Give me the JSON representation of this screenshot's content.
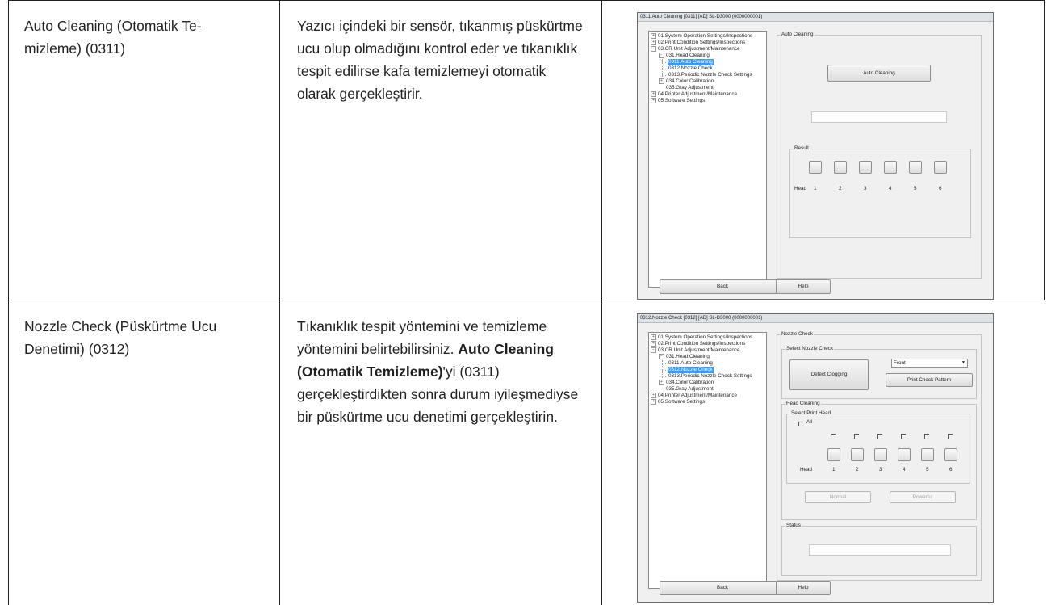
{
  "rows": [
    {
      "name": "Auto Cleaning (Otomatik Te-\nmizleme) (0311)",
      "desc": "Yazıcı içindeki bir sensör, tıkanmış püskürtme ucu olup olmadığını kontrol eder ve tıkanıklık tespit edilirse kafa temizlemeyi otomatik olarak gerçekleştirir."
    },
    {
      "name": "Nozzle Check (Püskürtme Ucu Denetimi) (0312)",
      "desc_part1": "Tıkanıklık tespit yöntemini ve temizleme yöntemini belirtebilirsiniz. ",
      "desc_bold": "Auto Cleaning (Otomatik Temizleme)",
      "desc_part2": "'yi (0311) gerçekleştirdikten sonra durum iyileşmediyse bir püskürtme ucu denetimi gerçekleştirin."
    }
  ],
  "win1": {
    "title": "0311.Auto Cleaning  [0311]  [AD]  SL-D3000  (0000000001)",
    "group_label": "Auto Cleaning",
    "auto_cleaning_button": "Auto Cleaning",
    "result_label": "Result",
    "head_label": "Head",
    "heads": [
      "1",
      "2",
      "3",
      "4",
      "5",
      "6"
    ],
    "back_button": "Back",
    "help_button": "Help"
  },
  "win2": {
    "title": "0312.Nozzle Check  [0312]  [AD]  SL-D3000  (0000000001)",
    "group_label": "Nozzle Check",
    "select_nozzle_label": "Select Nozzle Check",
    "detect_button": "Detect Clogging",
    "combo_value": "Front",
    "print_pattern_button": "Print Check Pattern",
    "head_cleaning_label": "Head Cleaning",
    "select_head_label": "Select Print Head",
    "all_label": "All",
    "head_label": "Head",
    "heads": [
      "1",
      "2",
      "3",
      "4",
      "5",
      "6"
    ],
    "normal_button": "Normal",
    "powerful_button": "Powerful",
    "status_label": "Status",
    "back_button": "Back",
    "help_button": "Help"
  },
  "tree": {
    "i01": "01.System Operation Settings/Inspections",
    "i02": "02.Print Condition Settings/Inspections",
    "i03": "03.CR Unit Adjustment/Maintenance",
    "i031": "031.Head Cleaning",
    "i0311": "0311.Auto Cleaning",
    "i0312": "0312.Nozzle Check",
    "i0313": "0313.Periodic Nozzle Check Settings",
    "i034": "034.Color Calibration",
    "i035": "035.Gray Adjustment",
    "i04": "04.Printer Adjustment/Maintenance",
    "i05": "05.Software Settings"
  }
}
